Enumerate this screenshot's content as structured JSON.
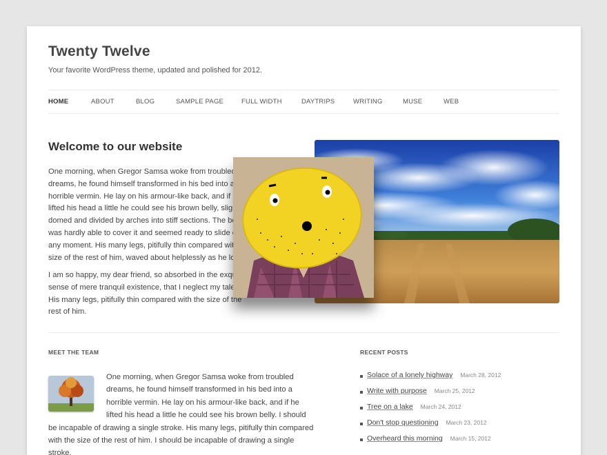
{
  "site": {
    "title": "Twenty Twelve",
    "description": "Your favorite WordPress theme, updated and polished for 2012."
  },
  "nav": {
    "items": [
      {
        "label": "HOME",
        "active": true
      },
      {
        "label": "ABOUT"
      },
      {
        "label": "BLOG"
      },
      {
        "label": "SAMPLE PAGE"
      },
      {
        "label": "FULL WIDTH"
      },
      {
        "label": "DAYTRIPS"
      },
      {
        "label": "WRITING"
      },
      {
        "label": "MUSE"
      },
      {
        "label": "WEB"
      }
    ]
  },
  "main": {
    "heading": "Welcome to our website",
    "paragraph1": "One morning, when Gregor Samsa woke from troubled dreams, he found himself transformed in his bed into a horrible vermin. He lay on his armour-like back, and if he lifted his head a little he could see his brown belly, slightly domed and divided by arches into stiff sections. The bedding was hardly able to cover it and seemed ready to slide off any moment. His many legs, pitifully thin compared with the size of the rest of him, waved about helplessly as he looked.",
    "paragraph2": "I am so happy, my dear friend, so absorbed in the exquisite sense of mere tranquil existence, that I neglect my talents. His many legs, pitifully thin compared with the size of the rest of him."
  },
  "team": {
    "title": "MEET THE TEAM",
    "text": "One morning, when Gregor Samsa woke from troubled dreams, he found himself transformed in his bed into a horrible vermin. He lay on his armour-like back, and if he lifted his head a little he could see his brown belly. I should be incapable of drawing a single stroke. His many legs, pitifully thin compared with the size of the rest of him. I should be incapable of drawing a single stroke."
  },
  "recent": {
    "title": "RECENT POSTS",
    "posts": [
      {
        "title": "Solace of a lonely highway",
        "date": "March 28, 2012"
      },
      {
        "title": "Write with purpose",
        "date": "March 25, 2012"
      },
      {
        "title": "Tree on a lake",
        "date": "March 24, 2012"
      },
      {
        "title": "Don't stop questioning",
        "date": "March 23, 2012"
      },
      {
        "title": "Overheard this morning",
        "date": "March 15, 2012"
      }
    ]
  },
  "colors": {
    "page_bg": "#e6e6e6",
    "lemon": "#f2d323",
    "sky": "#2f64c6",
    "wheat": "#c79a52"
  },
  "icons": [
    "landscape-photo",
    "lemon-face-photo",
    "autumn-tree-photo"
  ]
}
